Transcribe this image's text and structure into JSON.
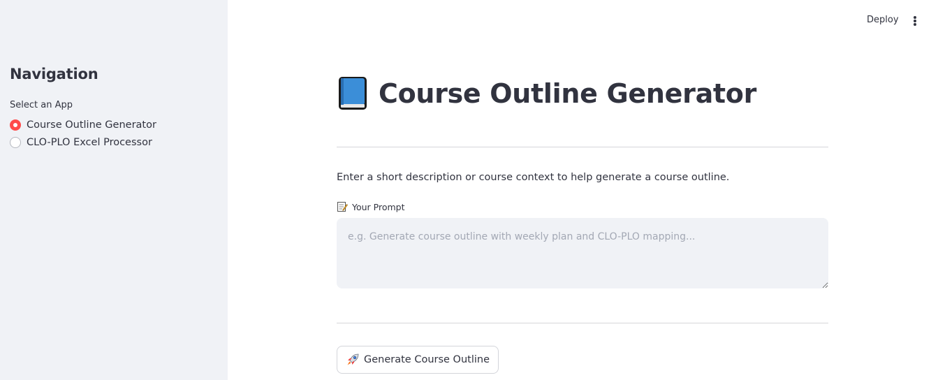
{
  "header": {
    "deploy_label": "Deploy",
    "menu_icon": "more-vertical-icon"
  },
  "sidebar": {
    "title": "Navigation",
    "radio_label": "Select an App",
    "options": [
      {
        "label": "Course Outline Generator",
        "selected": true
      },
      {
        "label": "CLO-PLO Excel Processor",
        "selected": false
      }
    ],
    "accent_color": "#ff4b4b"
  },
  "main": {
    "title_icon": "blue-book-icon",
    "title": "Course Outline Generator",
    "description": "Enter a short description or course context to help generate a course outline.",
    "prompt": {
      "icon": "memo-icon",
      "label": "Your Prompt",
      "value": "",
      "placeholder": "e.g. Generate course outline with weekly plan and CLO-PLO mapping..."
    },
    "generate_button": {
      "icon": "rocket-icon",
      "label": "Generate Course Outline"
    }
  }
}
